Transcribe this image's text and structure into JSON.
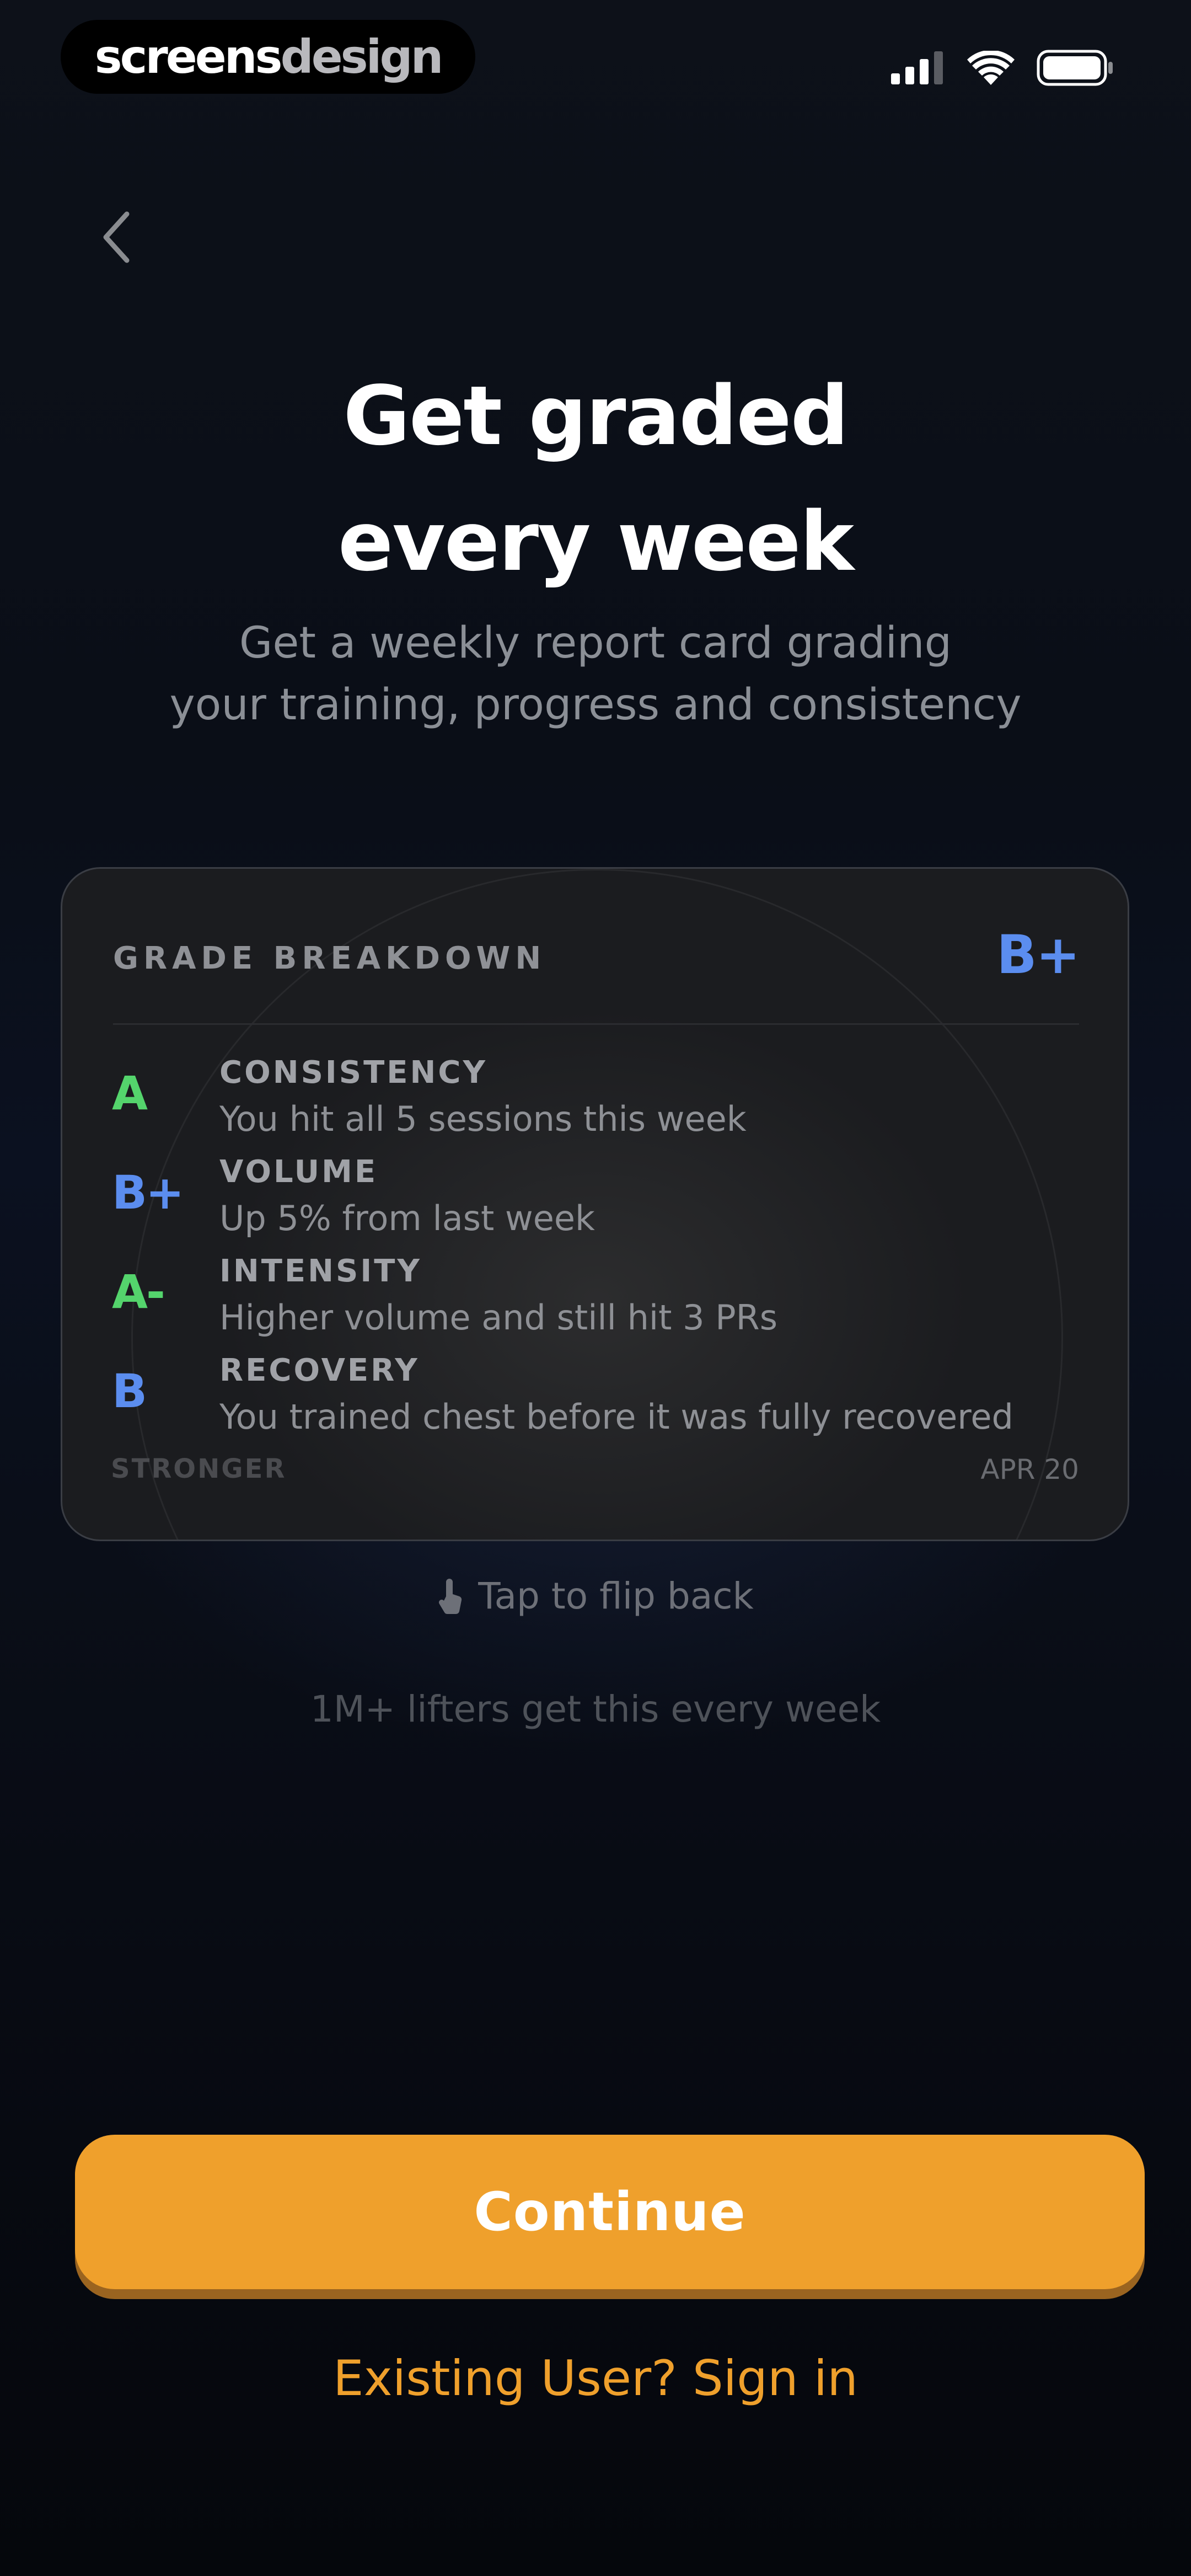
{
  "status_bar": {
    "brand_primary": "screens",
    "brand_secondary": "design",
    "icons": [
      "cellular-signal-icon",
      "wifi-icon",
      "battery-icon"
    ]
  },
  "header": {
    "back_icon": "chevron-left-icon",
    "title_line1": "Get graded",
    "title_line2": "every week",
    "subtitle_line1": "Get a weekly report card grading",
    "subtitle_line2": "your training, progress and consistency"
  },
  "card": {
    "header_label": "GRADE BREAKDOWN",
    "overall_grade": "B+",
    "grades": [
      {
        "letter": "A",
        "label": "CONSISTENCY",
        "description": "You hit all 5 sessions this week",
        "color": "#54d46c"
      },
      {
        "letter": "B+",
        "label": "VOLUME",
        "description": "Up 5% from last week",
        "color": "#5b8def"
      },
      {
        "letter": "A-",
        "label": "INTENSITY",
        "description": "Higher volume and still hit 3 PRs",
        "color": "#54d46c"
      },
      {
        "letter": "B",
        "label": "RECOVERY",
        "description": "You trained chest before it was fully recovered",
        "color": "#5b8def"
      }
    ],
    "logo_text": "STRONGER",
    "date": "APR 20"
  },
  "flip_hint": {
    "icon": "hand-tap-icon",
    "text": "Tap to flip back"
  },
  "social_proof": "1M+ lifters get this every week",
  "actions": {
    "continue_label": "Continue",
    "signin_label": "Existing User? Sign in"
  },
  "colors": {
    "accent": "#efa02c",
    "grade_green": "#54d46c",
    "grade_blue": "#5b8def",
    "background": "#07090f"
  }
}
